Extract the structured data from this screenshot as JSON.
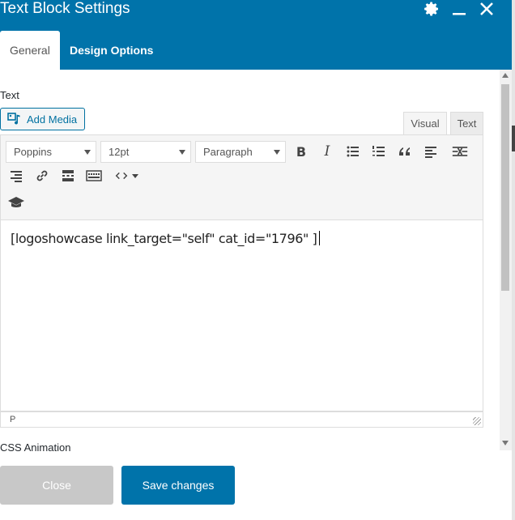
{
  "window": {
    "title": "Text Block Settings",
    "icons": [
      "gear-icon",
      "minimize-icon",
      "close-icon"
    ]
  },
  "tabs": [
    {
      "label": "General",
      "active": true
    },
    {
      "label": "Design Options",
      "active": false
    }
  ],
  "field": {
    "label": "Text",
    "add_media_label": "Add Media"
  },
  "editor_tabs": {
    "visual": "Visual",
    "text": "Text"
  },
  "toolbar": {
    "font_family": "Poppins",
    "font_size": "12pt",
    "format": "Paragraph",
    "icons": [
      "bold-icon",
      "italic-icon",
      "bullet-list-icon",
      "numbered-list-icon",
      "blockquote-icon",
      "align-left-icon",
      "fullscreen-icon",
      "align-right-icon",
      "link-icon",
      "read-more-icon",
      "toolbar-toggle-icon",
      "code-icon",
      "graduation-cap-icon"
    ]
  },
  "editor": {
    "content": "[logoshowcase link_target=\"self\" cat_id=\"1796\" ]",
    "status_path": "P"
  },
  "section_next": {
    "label": "CSS Animation"
  },
  "footer": {
    "close_label": "Close",
    "save_label": "Save changes"
  },
  "colors": {
    "header_bg": "#0073aa",
    "save_bg": "#0073aa",
    "close_bg": "#c8c8c8"
  }
}
